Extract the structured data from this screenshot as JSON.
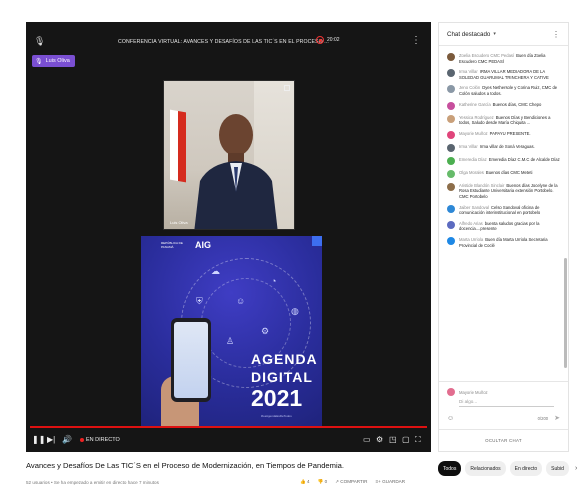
{
  "player": {
    "title": "CONFERENCIA VIRTUAL: AVANCES Y DESAFÍOS DE LAS TIC´S EN EL PROCESO ...",
    "viewers": "20:02",
    "host_badge": "Luis Oliva",
    "camera_caption": "Luis Oliva",
    "live_label": "EN DIRECTO",
    "progress_fraction": 1.0
  },
  "slide": {
    "logo_text": "AIG",
    "republic_text": "REPÚBLICA DE PANAMÁ",
    "agenda_line1": "AGENDA",
    "agenda_line2": "DIGITAL",
    "agenda_year": "2021",
    "footer": "#LaAgendaEsDeTodos"
  },
  "chat": {
    "header": "Chat destacado",
    "messages": [
      {
        "author": "Zoelia Escudero CMC Pedasí",
        "text": "Buen día Zoelia Escudero CMC PEDASÍ",
        "color": "#7b5a3c"
      },
      {
        "author": "Irma Villar",
        "text": "IRMA VILLAR MEDIADORA DE LA SOLEDAD GUARUMAL TRINCHERA Y CATIVE",
        "color": "#5a6570"
      },
      {
        "author": "Jeno Colón",
        "text": "Dyes Nethersole y Corina Ruiz, CMC de Colón saludos a todos.",
        "color": "#8a98a6"
      },
      {
        "author": "Katherine García",
        "text": "Buenos días, CMC Chepo",
        "color": "#c74f9d"
      },
      {
        "author": "Yessica Rodríguez",
        "text": "Buenos Días y Bendiciones a todos, Saludo desde María Chiquita ...",
        "color": "#c9a07a"
      },
      {
        "author": "Mayorie Muñoz",
        "text": "PAPAYU PRESENTE.",
        "color": "#e0457b"
      },
      {
        "author": "Irma Villar",
        "text": "Irma villar de Soná Veraguas.",
        "color": "#5a6570"
      },
      {
        "author": "Emeredia Díaz",
        "text": "Emeredia Díaz C.M.C de Alcalde Díaz",
        "color": "#4caf50"
      },
      {
        "author": "Olga Morales",
        "text": "Buenos días CMC Meteti",
        "color": "#66bb6a"
      },
      {
        "author": "Aristide Blandón Sinclair",
        "text": "Buenos días Jocelyne de la Rosa Estudiante Universitaria extensión Portobelo. CMC Portobelo",
        "color": "#8d6e4a"
      },
      {
        "author": "Jaiber Sandoval",
        "text": "Celso Sandoval oficina de comunicación interinstitucional en portobelo",
        "color": "#2e88d6"
      },
      {
        "author": "Alfredo Arias",
        "text": "buenta saludos gracias por la docencia....presente",
        "color": "#5c6bc0"
      },
      {
        "author": "Marta Urriola",
        "text": "Buen día Marta Urriola Secretaria Provincial de Coclé",
        "color": "#1e88e5"
      }
    ],
    "composer_user": "Mayorie Muñoz",
    "composer_placeholder": "Di algo...",
    "char_count": "0/200",
    "hide_chat": "OCULTAR CHAT"
  },
  "video": {
    "title": "Avances y Desafíos De Las TIC´S en el Proceso de Modernización, en Tiempos de Pandemia.",
    "meta": "52 usuarios • Se ha empezado a emitir en directo hace 7 minutos",
    "likes": "4",
    "dislikes": "0",
    "share": "COMPARTIR",
    "save": "GUARDAR"
  },
  "chips": [
    "Todos",
    "Relacionados",
    "En directo",
    "Subid"
  ]
}
